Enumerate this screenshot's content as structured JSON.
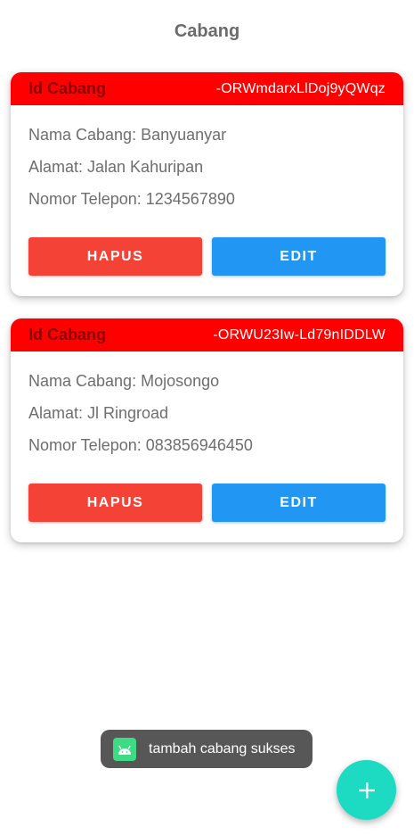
{
  "header": {
    "title": "Cabang"
  },
  "branches": [
    {
      "id_label": "Id Cabang",
      "id_value": "-ORWmdarxLlDoj9yQWqz",
      "nama": "Nama Cabang: Banyuanyar",
      "alamat": "Alamat: Jalan Kahuripan",
      "telepon": "Nomor Telepon: 1234567890",
      "hapus_label": "HAPUS",
      "edit_label": "EDIT"
    },
    {
      "id_label": "Id Cabang",
      "id_value": "-ORWU23Iw-Ld79nIDDLW",
      "nama": "Nama Cabang: Mojosongo",
      "alamat": "Alamat: Jl Ringroad",
      "telepon": "Nomor Telepon: 083856946450",
      "hapus_label": "HAPUS",
      "edit_label": "EDIT"
    }
  ],
  "toast": {
    "icon": "android-icon",
    "message": "tambah cabang sukses"
  },
  "fab": {
    "icon": "plus-icon"
  },
  "colors": {
    "header_bg": "#ff0000",
    "hapus": "#f44336",
    "edit": "#2196f3",
    "fab": "#1ddbc3"
  }
}
